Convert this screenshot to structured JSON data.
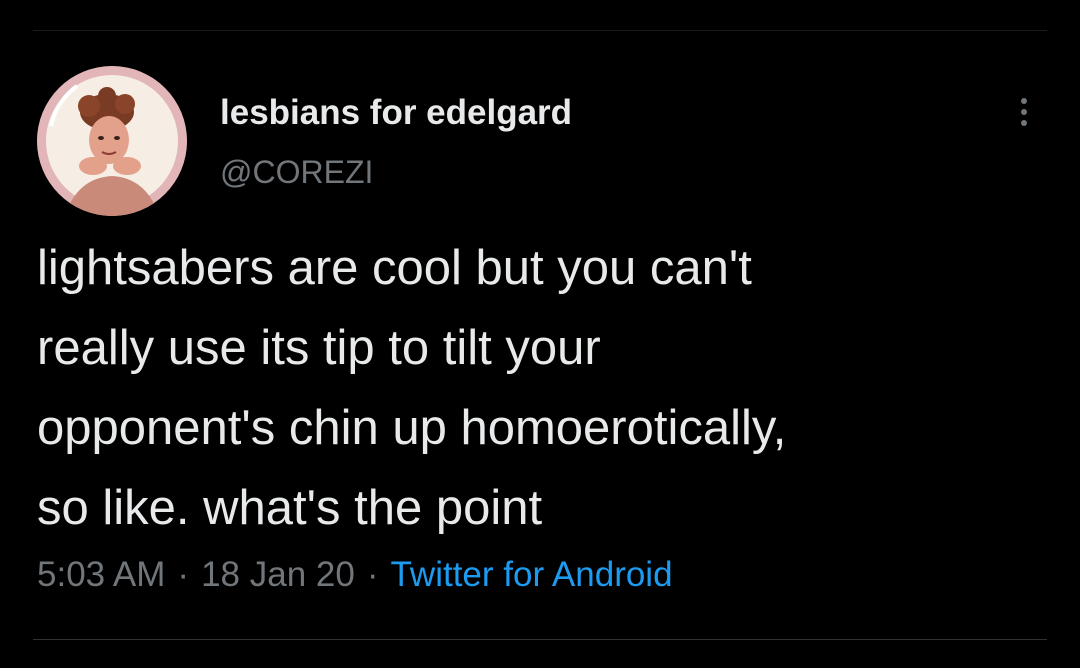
{
  "tweet": {
    "author": {
      "display_name": "lesbians for edelgard",
      "handle": "@COREZI"
    },
    "text": "lightsabers are cool but you can't\nreally use its tip to tilt your\nopponent's chin up homoerotically,\nso like. what's the point",
    "time": "5:03 AM",
    "date": "18 Jan 20",
    "separator": "·",
    "source": "Twitter for Android"
  },
  "icons": {
    "more": "more-options-icon",
    "avatar": "profile-avatar"
  },
  "colors": {
    "background": "#000000",
    "text": "#e7e9ea",
    "secondary": "#71767b",
    "link": "#1d9bf0",
    "avatar_ring": "#d9a8ad"
  }
}
